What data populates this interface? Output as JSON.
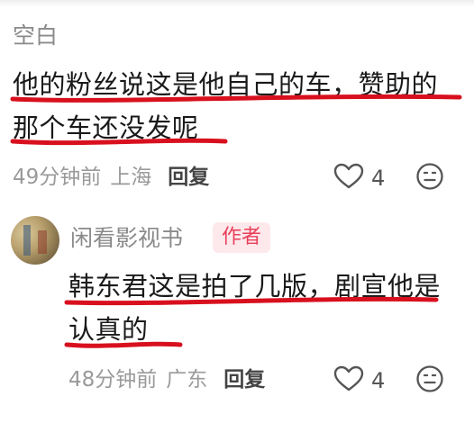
{
  "comment1": {
    "username": "空白",
    "text": "他的粉丝说这是他自己的车，赞助的那个车还没发呢",
    "time": "49分钟前",
    "location": "上海",
    "reply_label": "回复",
    "like_count": "4"
  },
  "comment2": {
    "username": "闲看影视书",
    "badge": "作者",
    "text": "韩东君这是拍了几版，剧宣他是认真的",
    "time": "48分钟前",
    "location": "广东",
    "reply_label": "回复",
    "like_count": "4"
  },
  "colors": {
    "underline_red": "#d8101e",
    "badge_text": "#e8405a",
    "badge_bg": "#fde9ec",
    "meta_gray": "#9a9a9a"
  },
  "icons": [
    "heart-icon",
    "dislike-face-icon"
  ]
}
